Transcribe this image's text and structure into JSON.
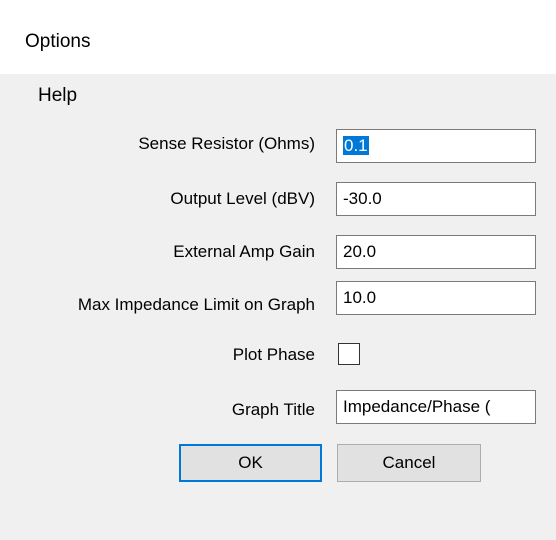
{
  "window": {
    "title": "Options"
  },
  "menu": {
    "help_label": "Help"
  },
  "form": {
    "sense_resistor": {
      "label": "Sense Resistor (Ohms)",
      "value": "0.1"
    },
    "output_level": {
      "label": "Output Level (dBV)",
      "value": "-30.0"
    },
    "external_amp_gain": {
      "label": "External Amp Gain",
      "value": "20.0"
    },
    "max_impedance": {
      "label": "Max Impedance Limit on Graph",
      "value": "10.0"
    },
    "plot_phase": {
      "label": "Plot Phase",
      "checked": false
    },
    "graph_title": {
      "label": "Graph Title",
      "value": "Impedance/Phase ("
    }
  },
  "buttons": {
    "ok_label": "OK",
    "cancel_label": "Cancel"
  },
  "colors": {
    "selection": "#0078d7",
    "dialog_background": "#f0f0f0",
    "default_button_border": "#0078d7"
  }
}
